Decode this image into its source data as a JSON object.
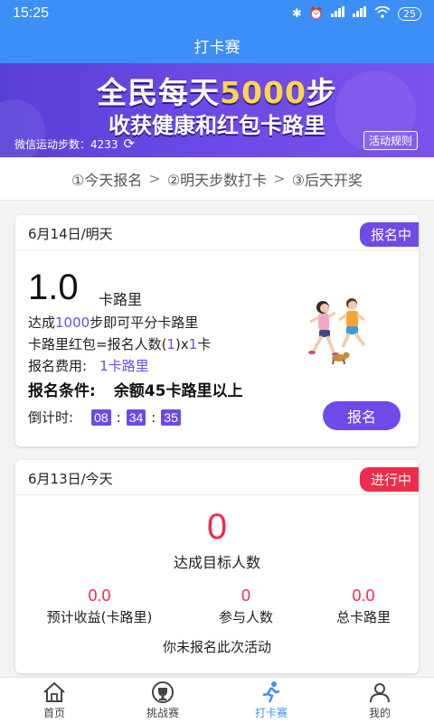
{
  "status_bar": {
    "time": "15:25",
    "battery": "25"
  },
  "title": "打卡赛",
  "banner": {
    "headline_prefix": "全民每天",
    "headline_highlight": "5000",
    "headline_suffix": "步",
    "subline": "收获健康和红包卡路里",
    "steps_text": "微信运动步数：4233",
    "rules_button": "活动规则"
  },
  "steps_bar": {
    "step1": "①今天报名",
    "step2": "②明天步数打卡",
    "step3": "③后天开奖",
    "arrow": ">"
  },
  "card_tomorrow": {
    "date": "6月14日/明天",
    "badge": "报名中",
    "amount": "1.0",
    "amount_unit": "卡路里",
    "line1_prefix": "达成",
    "line1_num": "1000",
    "line1_suffix": "步即可平分卡路里",
    "line2_prefix": "卡路里红包=报名人数(",
    "line2_num": "1",
    "line2_mid": ")x",
    "line2_num2": "1",
    "line2_suffix": "卡",
    "fee_label": "报名费用:",
    "fee_value": "1卡路里",
    "cond_label": "报名条件:",
    "cond_value": "余额45卡路里以上",
    "countdown_label": "倒计时:",
    "countdown": {
      "h": "08",
      "m": "34",
      "s": "35",
      "sep": ":"
    },
    "signup_button": "报名"
  },
  "card_today": {
    "date": "6月13日/今天",
    "badge": "进行中",
    "big_number": "0",
    "big_label": "达成目标人数",
    "stats": [
      {
        "value": "0.0",
        "label": "预计收益(卡路里)"
      },
      {
        "value": "0",
        "label": "参与人数"
      },
      {
        "value": "0.0",
        "label": "总卡路里"
      }
    ],
    "not_joined": "你未报名此次活动"
  },
  "tabbar": [
    {
      "label": "首页",
      "icon": "home-icon"
    },
    {
      "label": "挑战赛",
      "icon": "trophy-icon"
    },
    {
      "label": "打卡赛",
      "icon": "runner-icon"
    },
    {
      "label": "我的",
      "icon": "user-icon"
    }
  ],
  "colors": {
    "primary_blue": "#3b8ff6",
    "purple": "#6e4be8",
    "red": "#ef2c4b"
  }
}
